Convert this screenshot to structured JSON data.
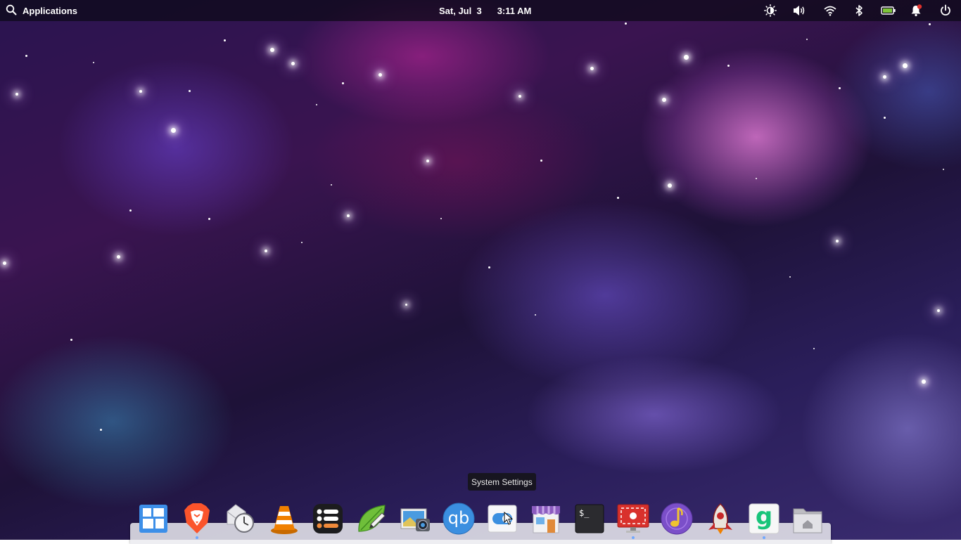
{
  "top_panel": {
    "applications_label": "Applications",
    "date": "Sat, Jul  3",
    "time": "3:11 AM",
    "indicators": [
      "brightness-icon",
      "volume-icon",
      "wifi-icon",
      "bluetooth-icon",
      "battery-icon",
      "notifications-icon",
      "power-icon"
    ]
  },
  "tooltip": {
    "text": "System Settings"
  },
  "dock": {
    "items": [
      {
        "name": "multitasking-view",
        "icon": "multitasking-icon"
      },
      {
        "name": "brave-browser",
        "icon": "brave-lion-icon"
      },
      {
        "name": "mail",
        "icon": "mail-clock-icon"
      },
      {
        "name": "vlc",
        "icon": "vlc-cone-icon"
      },
      {
        "name": "tasks",
        "icon": "list-icon"
      },
      {
        "name": "code-editor",
        "icon": "leaf-pen-icon"
      },
      {
        "name": "screenshot",
        "icon": "photo-camera-icon"
      },
      {
        "name": "qbittorrent",
        "icon": "qb-icon",
        "label": "qb"
      },
      {
        "name": "system-settings",
        "icon": "toggle-switch-icon"
      },
      {
        "name": "appcenter",
        "icon": "store-icon"
      },
      {
        "name": "terminal",
        "icon": "terminal-icon",
        "label": "$_"
      },
      {
        "name": "screen-recorder",
        "icon": "screen-recorder-icon"
      },
      {
        "name": "music",
        "icon": "music-note-icon"
      },
      {
        "name": "rocket-app",
        "icon": "rocket-icon"
      },
      {
        "name": "g-app",
        "icon": "g-icon",
        "label": "g"
      },
      {
        "name": "files",
        "icon": "folder-home-icon"
      }
    ]
  },
  "colors": {
    "panel_bg": "#0a0814",
    "accent_blue": "#3b8fe0",
    "vlc_orange": "#f08000",
    "brave_orange": "#fb542b"
  }
}
